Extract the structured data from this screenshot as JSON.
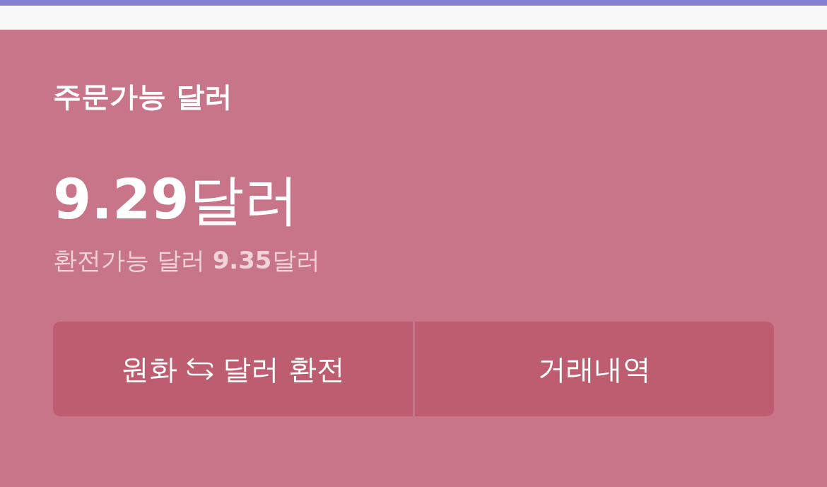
{
  "balance": {
    "title": "주문가능 달러",
    "amount": "**9.29**달러",
    "exchangeable": "환전가능 달러 **9.35**달러"
  },
  "buttons": [
    {
      "kind": "exchange",
      "label_before": "원화",
      "label_after": "달러 환전"
    },
    {
      "kind": "plain",
      "label": "거래내역"
    }
  ]
}
